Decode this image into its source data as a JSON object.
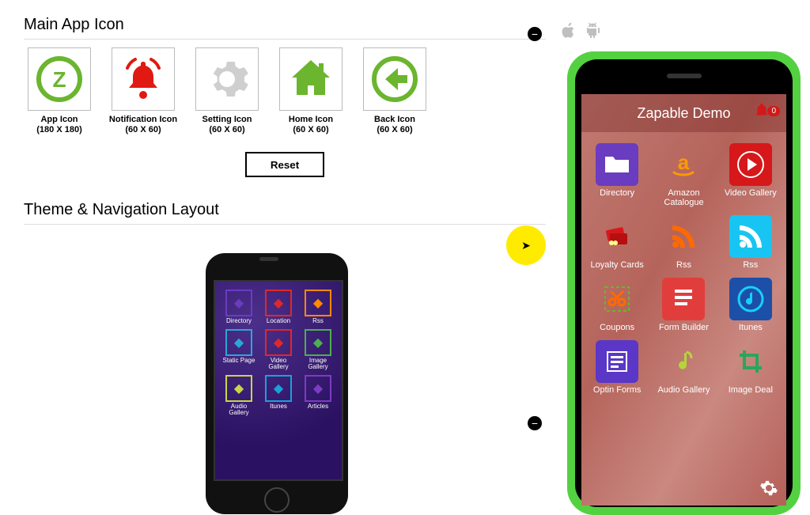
{
  "section1": {
    "title": "Main App Icon",
    "icons": [
      {
        "name": "app-icon",
        "label": "App Icon",
        "dim": "(180 X 180)",
        "color": "#6bb52f"
      },
      {
        "name": "notification-icon",
        "label": "Notification Icon",
        "dim": "(60 X 60)",
        "color": "#e11913"
      },
      {
        "name": "settings-icon",
        "label": "Setting Icon",
        "dim": "(60 X 60)",
        "color": "#cfcfcf"
      },
      {
        "name": "home-icon",
        "label": "Home Icon",
        "dim": "(60 X 60)",
        "color": "#6bb52f"
      },
      {
        "name": "back-icon",
        "label": "Back Icon",
        "dim": "(60 X 60)",
        "color": "#6bb52f"
      }
    ],
    "reset": "Reset"
  },
  "section2": {
    "title": "Theme & Navigation Layout"
  },
  "mini": {
    "items": [
      {
        "label": "Directory",
        "c": "#6a3cc0"
      },
      {
        "label": "Location",
        "c": "#e02828"
      },
      {
        "label": "Rss",
        "c": "#ff8a00"
      },
      {
        "label": "Static Page",
        "c": "#2aa7d5"
      },
      {
        "label": "Video Gallery",
        "c": "#e02828"
      },
      {
        "label": "Image Gallery",
        "c": "#4caf50"
      },
      {
        "label": "Audio Gallery",
        "c": "#c7d64a"
      },
      {
        "label": "Itunes",
        "c": "#1aa1d6"
      },
      {
        "label": "Articles",
        "c": "#7c3cc0"
      }
    ]
  },
  "big": {
    "title": "Zapable Demo",
    "notif_count": "0",
    "items": [
      {
        "label": "Directory",
        "bg": "#6a3cc0",
        "icon": "folder"
      },
      {
        "label": "Amazon Catalogue",
        "bg": "",
        "icon": "amazon"
      },
      {
        "label": "Video Gallery",
        "bg": "#d6181a",
        "icon": "play"
      },
      {
        "label": "Loyalty Cards",
        "bg": "",
        "icon": "cards"
      },
      {
        "label": "Rss",
        "bg": "",
        "icon": "rss-orange"
      },
      {
        "label": "Rss",
        "bg": "#18c5f2",
        "icon": "rss-white"
      },
      {
        "label": "Coupons",
        "bg": "",
        "icon": "cut"
      },
      {
        "label": "Form Builder",
        "bg": "#e23d3d",
        "icon": "form"
      },
      {
        "label": "Itunes",
        "bg": "#1b4fa8",
        "icon": "note"
      },
      {
        "label": "Optin Forms",
        "bg": "#5a37c7",
        "icon": "list"
      },
      {
        "label": "Audio Gallery",
        "bg": "",
        "icon": "music"
      },
      {
        "label": "Image Deal",
        "bg": "",
        "icon": "crop"
      }
    ]
  }
}
